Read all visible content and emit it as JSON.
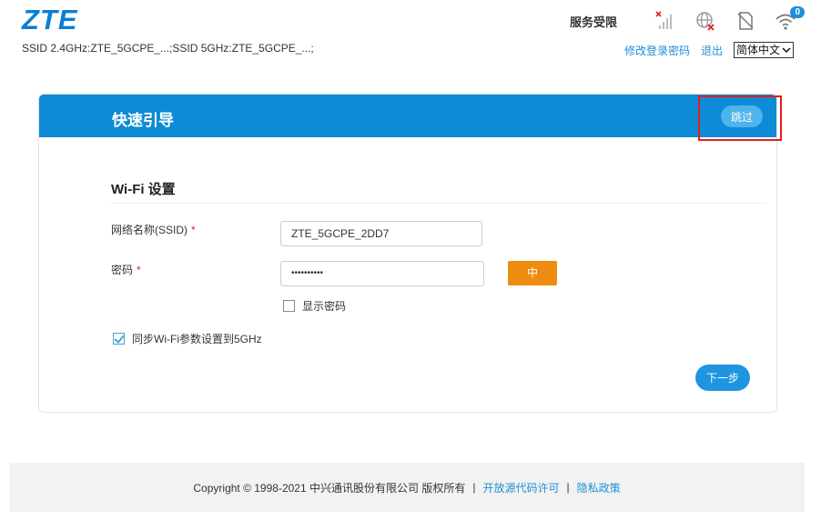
{
  "header": {
    "logo": "ZTE",
    "ssid_info": "SSID 2.4GHz:ZTE_5GCPE_...;SSID 5GHz:ZTE_5GCPE_...;",
    "service_status": "服务受限",
    "wifi_client_count": "0",
    "links": {
      "change_password": "修改登录密码",
      "logout": "退出"
    },
    "language": {
      "selected": "简体中文"
    },
    "icons": [
      "signal-no-service-icon",
      "network-disconnected-icon",
      "no-sim-icon",
      "wifi-icon"
    ]
  },
  "wizard": {
    "title": "快速引导",
    "skip_label": "跳过",
    "section_title": "Wi-Fi 设置",
    "ssid": {
      "label": "网络名称(SSID)",
      "required_mark": "*",
      "value": "ZTE_5GCPE_2DD7"
    },
    "password": {
      "label": "密码",
      "required_mark": "*",
      "value": "••••••••••",
      "strength": "中"
    },
    "show_password": {
      "label": "显示密码",
      "checked": false
    },
    "sync_5ghz": {
      "label": "同步Wi-Fi参数设置到5GHz",
      "checked": true
    },
    "next_label": "下一步"
  },
  "footer": {
    "copyright": "Copyright © 1998-2021 中兴通讯股份有限公司 版权所有",
    "separator": "|",
    "open_source": "开放源代码许可",
    "privacy": "隐私政策"
  },
  "colors": {
    "brand_blue": "#0d8bd6",
    "link_blue": "#1e8fd9",
    "strength_orange": "#ee8c11",
    "highlight_red": "#e01f1f"
  }
}
